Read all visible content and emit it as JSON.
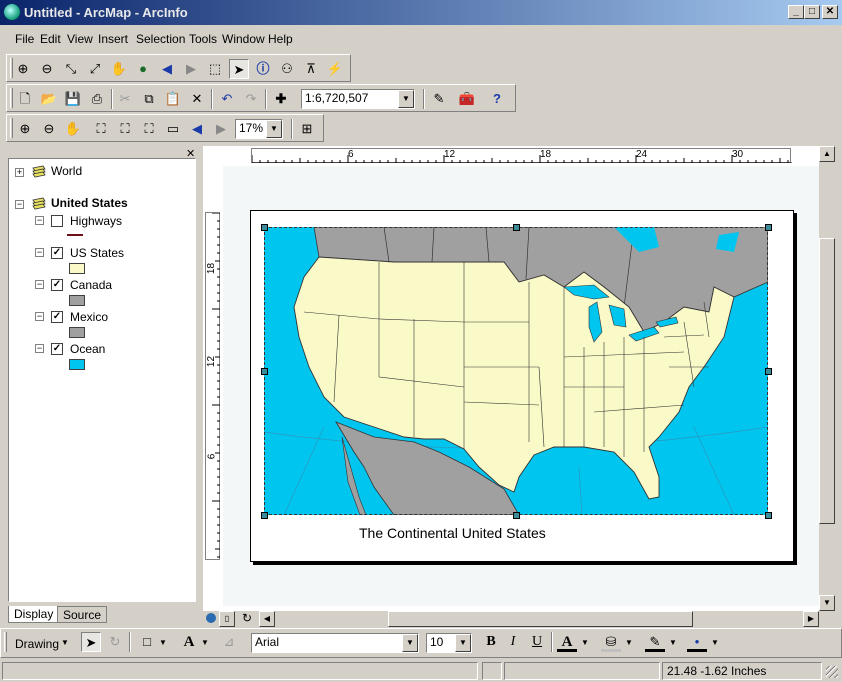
{
  "window": {
    "title": "Untitled - ArcMap - ArcInfo",
    "min": "_",
    "max": "□",
    "close": "✕"
  },
  "menu": [
    "File",
    "Edit",
    "View",
    "Insert",
    "Selection",
    "Tools",
    "Window",
    "Help"
  ],
  "standard_toolbar": {
    "scale": "1:6,720,507"
  },
  "layout_toolbar": {
    "zoom": "17%"
  },
  "toc": {
    "layers_top": "World",
    "group": "United States",
    "layers": [
      {
        "name": "Highways",
        "checked": false,
        "swatch": "#6b0f1a"
      },
      {
        "name": "US States",
        "checked": true,
        "swatch": "#fafac8"
      },
      {
        "name": "Canada",
        "checked": true,
        "swatch": "#a0a0a0"
      },
      {
        "name": "Mexico",
        "checked": true,
        "swatch": "#a0a0a0"
      },
      {
        "name": "Ocean",
        "checked": true,
        "swatch": "#00c5ef"
      }
    ],
    "tabs": {
      "display": "Display",
      "source": "Source"
    }
  },
  "rulers": {
    "h": [
      "6",
      "12",
      "18",
      "24",
      "30"
    ],
    "v": [
      "18",
      "12",
      "6"
    ]
  },
  "map": {
    "title": "The Continental United States",
    "land": "#fafac8",
    "water": "#00c5ef",
    "neighbor": "#a0a0a0"
  },
  "drawing": {
    "label": "Drawing",
    "font": "Arial",
    "size": "10",
    "bold": "B",
    "italic": "I",
    "underline": "U"
  },
  "status": {
    "coords": "21.48  -1.62 Inches"
  }
}
